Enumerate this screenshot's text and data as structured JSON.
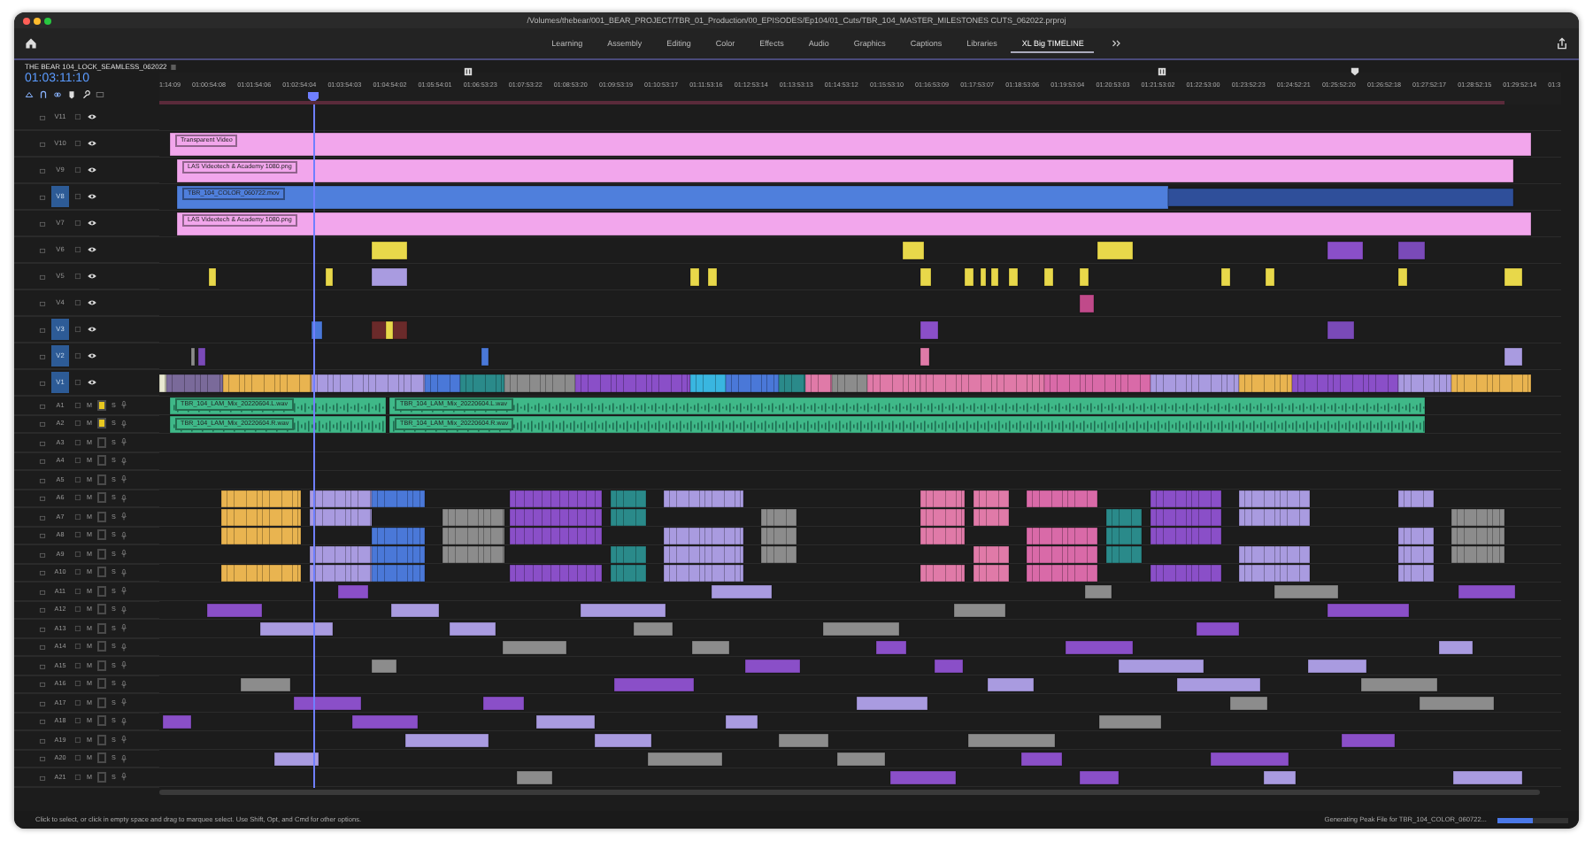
{
  "window": {
    "title": "/Volumes/thebear/001_BEAR_PROJECT/TBR_01_Production/00_EPISODES/Ep104/01_Cuts/TBR_104_MASTER_MILESTONES CUTS_062022.prproj"
  },
  "workspaces": [
    {
      "label": "Learning",
      "selected": false
    },
    {
      "label": "Assembly",
      "selected": false
    },
    {
      "label": "Editing",
      "selected": false
    },
    {
      "label": "Color",
      "selected": false
    },
    {
      "label": "Effects",
      "selected": false
    },
    {
      "label": "Audio",
      "selected": false
    },
    {
      "label": "Graphics",
      "selected": false
    },
    {
      "label": "Captions",
      "selected": false
    },
    {
      "label": "Libraries",
      "selected": false
    },
    {
      "label": "XL Big TIMELINE",
      "selected": true
    }
  ],
  "sequence": {
    "name": "THE BEAR 104_LOCK_SEAMLESS_062022",
    "timecode": "01:03:11:10"
  },
  "ruler": {
    "ticks": [
      "1:14:09",
      "01:00:54:08",
      "01:01:54:06",
      "01:02:54:04",
      "01:03:54:03",
      "01:04:54:02",
      "01:05:54:01",
      "01:06:53:23",
      "01:07:53:22",
      "01:08:53:20",
      "01:09:53:19",
      "01:10:53:17",
      "01:11:53:16",
      "01:12:53:14",
      "01:13:53:13",
      "01:14:53:12",
      "01:15:53:10",
      "01:16:53:09",
      "01:17:53:07",
      "01:18:53:06",
      "01:19:53:04",
      "01:20:53:03",
      "01:21:53:02",
      "01:22:53:00",
      "01:23:52:23",
      "01:24:52:21",
      "01:25:52:20",
      "01:26:52:18",
      "01:27:52:17",
      "01:28:52:15",
      "01:29:52:14",
      "01:3"
    ]
  },
  "video_tracks": [
    {
      "name": "V11",
      "targeted": false
    },
    {
      "name": "V10",
      "targeted": false,
      "clips": [
        {
          "label": "Transparent Video",
          "color": "#f2a6ec"
        }
      ]
    },
    {
      "name": "V9",
      "targeted": false,
      "clips": [
        {
          "label": "LAS Videotech & Academy 1080.png",
          "color": "#f2a6ec"
        }
      ]
    },
    {
      "name": "V8",
      "targeted": true,
      "clips": [
        {
          "label": "TBR_104_COLOR_060722.mov",
          "color": "#4f7fdc"
        }
      ]
    },
    {
      "name": "V7",
      "targeted": false,
      "clips": [
        {
          "label": "LAS Videotech & Academy 1080.png",
          "color": "#f2a6ec"
        }
      ]
    },
    {
      "name": "V6",
      "targeted": false
    },
    {
      "name": "V5",
      "targeted": false
    },
    {
      "name": "V4",
      "targeted": false
    },
    {
      "name": "V3",
      "targeted": true
    },
    {
      "name": "V2",
      "targeted": true
    },
    {
      "name": "V1",
      "targeted": true
    }
  ],
  "audio_tracks": [
    {
      "name": "A1",
      "targeted": true,
      "mute": "M",
      "solo": "S",
      "clips": [
        {
          "label": "TBR_104_LAM_Mix_20220604.L.wav",
          "color": "#3fb888"
        },
        {
          "label": "TBR_104_LAM_Mix_20220604.L.wav",
          "color": "#3fb888"
        }
      ]
    },
    {
      "name": "A2",
      "targeted": true,
      "mute": "M",
      "solo": "S",
      "clips": [
        {
          "label": "TBR_104_LAM_Mix_20220604.R.wav",
          "color": "#3fb888"
        },
        {
          "label": "TBR_104_LAM_Mix_20220604.R.wav",
          "color": "#3fb888"
        }
      ]
    },
    {
      "name": "A3",
      "targeted": false,
      "mute": "M",
      "solo": "S"
    },
    {
      "name": "A4",
      "targeted": false,
      "mute": "M",
      "solo": "S"
    },
    {
      "name": "A5",
      "targeted": false,
      "mute": "M",
      "solo": "S"
    },
    {
      "name": "A6",
      "targeted": false,
      "mute": "M",
      "solo": "S"
    },
    {
      "name": "A7",
      "targeted": false,
      "mute": "M",
      "solo": "S"
    },
    {
      "name": "A8",
      "targeted": false,
      "mute": "M",
      "solo": "S"
    },
    {
      "name": "A9",
      "targeted": false,
      "mute": "M",
      "solo": "S"
    },
    {
      "name": "A10",
      "targeted": false,
      "mute": "M",
      "solo": "S"
    },
    {
      "name": "A11",
      "targeted": false,
      "mute": "M",
      "solo": "S"
    },
    {
      "name": "A12",
      "targeted": false,
      "mute": "M",
      "solo": "S"
    },
    {
      "name": "A13",
      "targeted": false,
      "mute": "M",
      "solo": "S"
    },
    {
      "name": "A14",
      "targeted": false,
      "mute": "M",
      "solo": "S"
    },
    {
      "name": "A15",
      "targeted": false,
      "mute": "M",
      "solo": "S"
    },
    {
      "name": "A16",
      "targeted": false,
      "mute": "M",
      "solo": "S"
    },
    {
      "name": "A17",
      "targeted": false,
      "mute": "M",
      "solo": "S"
    },
    {
      "name": "A18",
      "targeted": false,
      "mute": "M",
      "solo": "S"
    },
    {
      "name": "A19",
      "targeted": false,
      "mute": "M",
      "solo": "S"
    },
    {
      "name": "A20",
      "targeted": false,
      "mute": "M",
      "solo": "S"
    },
    {
      "name": "A21",
      "targeted": false,
      "mute": "M",
      "solo": "S"
    }
  ],
  "status_bar": {
    "hint": "Click to select, or click in empty space and drag to marquee select. Use Shift, Opt, and Cmd for other options.",
    "task": "Generating Peak File for TBR_104_COLOR_060722...",
    "level": 0.5
  }
}
